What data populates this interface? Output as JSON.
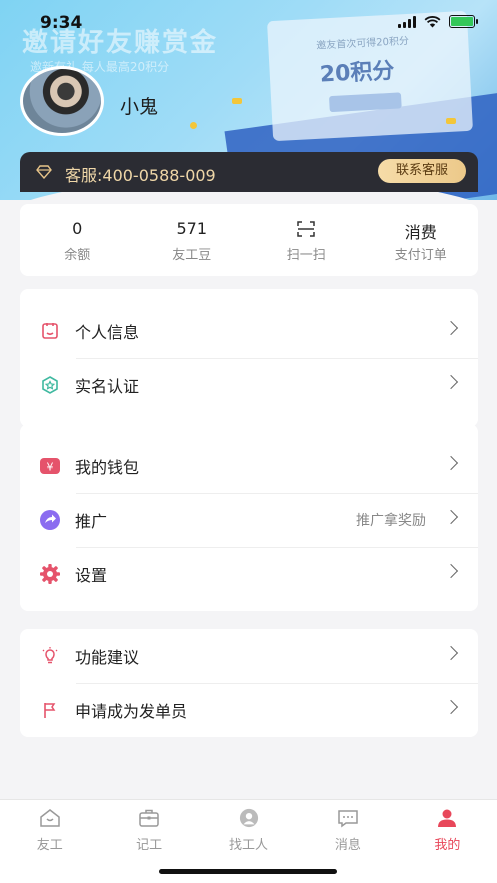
{
  "status_bar": {
    "time": "9:34"
  },
  "banner": {
    "headline": "邀请好友赚赏金",
    "subtext": "邀新有礼  每人最高20积分",
    "card_small": "邀友首次可得20积分",
    "card_big": "20积分"
  },
  "profile": {
    "username": "小鬼"
  },
  "service": {
    "text": "客服:400-0588-009",
    "button": "联系客服"
  },
  "stats": [
    {
      "value": "0",
      "label": "余额"
    },
    {
      "value": "571",
      "label": "友工豆"
    },
    {
      "value": "",
      "label": "扫一扫",
      "icon": "scan-icon"
    },
    {
      "value": "消费",
      "label": "支付订单"
    }
  ],
  "menu_group_1": [
    {
      "label": "个人信息",
      "icon": "id-card-icon",
      "color": "#e5536b"
    },
    {
      "label": "实名认证",
      "icon": "verified-icon",
      "color": "#3fb9a0"
    }
  ],
  "menu_group_2": [
    {
      "label": "我的钱包",
      "icon": "wallet-icon",
      "color": "#e5536b",
      "hint": ""
    },
    {
      "label": "推广",
      "icon": "share-icon",
      "color": "#8b6cf0",
      "hint": "推广拿奖励"
    },
    {
      "label": "设置",
      "icon": "gear-icon",
      "color": "#e5536b",
      "hint": ""
    }
  ],
  "menu_group_3": [
    {
      "label": "功能建议",
      "icon": "lightbulb-icon",
      "color": "#e5536b"
    },
    {
      "label": "申请成为发单员",
      "icon": "flag-icon",
      "color": "#e5536b"
    }
  ],
  "tabs": [
    {
      "label": "友工",
      "icon": "home-icon",
      "active": false
    },
    {
      "label": "记工",
      "icon": "briefcase-icon",
      "active": false
    },
    {
      "label": "找工人",
      "icon": "worker-icon",
      "active": false
    },
    {
      "label": "消息",
      "icon": "message-icon",
      "active": false
    },
    {
      "label": "我的",
      "icon": "profile-icon",
      "active": true
    }
  ],
  "colors": {
    "accent": "#e8475a",
    "service_bg": "#2b2c33",
    "service_text": "#efd7a8"
  }
}
